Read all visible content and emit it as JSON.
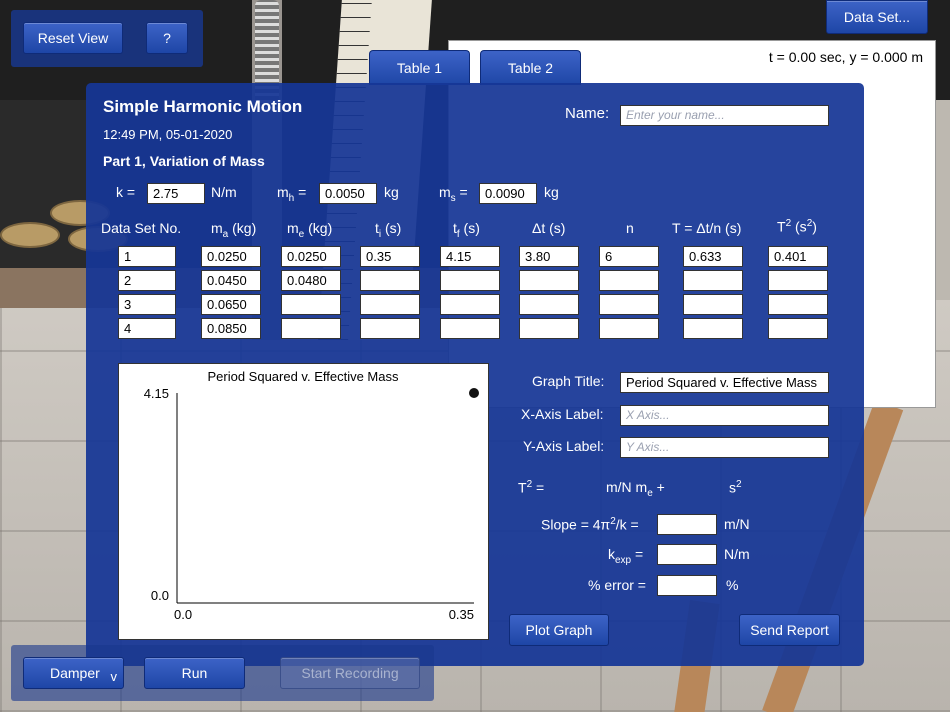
{
  "toolbar": {
    "reset_view": "Reset View",
    "help": "?",
    "data_set": "Data Set..."
  },
  "graph_window": {
    "readout": "t = 0.00 sec,  y = 0.000 m"
  },
  "tabs": [
    {
      "label": "Table 1",
      "active": true
    },
    {
      "label": "Table 2",
      "active": false
    }
  ],
  "panel": {
    "title": "Simple Harmonic Motion",
    "timestamp": "12:49 PM, 05-01-2020",
    "part": "Part 1, Variation of Mass",
    "name_label": "Name:",
    "name_placeholder": "Enter your name...",
    "name_value": ""
  },
  "constants": {
    "k_label": "k =",
    "k_value": "2.75",
    "k_unit": "N/m",
    "mh_label": "m",
    "mh_sub": "h",
    "mh_eq": " =",
    "mh_value": "0.0050",
    "mh_unit": "kg",
    "ms_label": "m",
    "ms_sub": "s",
    "ms_eq": " =",
    "ms_value": "0.0090",
    "ms_unit": "kg"
  },
  "table": {
    "headers": {
      "dataset": "Data Set No.",
      "ma": "m",
      "ma_sub": "a",
      "ma_unit": " (kg)",
      "me": "m",
      "me_sub": "e",
      "me_unit": " (kg)",
      "ti": "t",
      "ti_sub": "i",
      "ti_unit": " (s)",
      "tf": "t",
      "tf_sub": "f",
      "tf_unit": " (s)",
      "dt": "Δt (s)",
      "n": "n",
      "T": "T = Δt/n (s)",
      "T2": "T",
      "T2_sup": "2",
      "T2_unit": " (s",
      "T2_unit_sup": "2",
      "T2_unit_end": ")"
    },
    "rows": [
      {
        "no": "1",
        "ma": "0.0250",
        "me": "0.0250",
        "ti": "0.35",
        "tf": "4.15",
        "dt": "3.80",
        "n": "6",
        "T": "0.633",
        "T2": "0.401"
      },
      {
        "no": "2",
        "ma": "0.0450",
        "me": "0.0480",
        "ti": "",
        "tf": "",
        "dt": "",
        "n": "",
        "T": "",
        "T2": ""
      },
      {
        "no": "3",
        "ma": "0.0650",
        "me": "",
        "ti": "",
        "tf": "",
        "dt": "",
        "n": "",
        "T": "",
        "T2": ""
      },
      {
        "no": "4",
        "ma": "0.0850",
        "me": "",
        "ti": "",
        "tf": "",
        "dt": "",
        "n": "",
        "T": "",
        "T2": ""
      }
    ]
  },
  "graph": {
    "title_label": "Graph Title:",
    "title_value": "Period Squared v. Effective Mass",
    "x_label": "X-Axis Label:",
    "x_placeholder": "X Axis...",
    "y_label": "Y-Axis Label:",
    "y_placeholder": "Y Axis..."
  },
  "chart_data": {
    "type": "scatter",
    "title": "Period Squared v. Effective Mass",
    "xlabel": "",
    "ylabel": "",
    "xlim": [
      0.0,
      0.35
    ],
    "ylim": [
      0.0,
      4.15
    ],
    "x_tick_labels": [
      "0.0",
      "0.35"
    ],
    "y_tick_labels": [
      "0.0",
      "4.15"
    ],
    "series": [
      {
        "points": [
          {
            "x": 0.35,
            "y": 4.15
          }
        ],
        "color": "#111111"
      }
    ],
    "grid": false
  },
  "equation": {
    "t2": "T",
    "t2_sup": "2",
    "eq": " =",
    "mid": "m/N m",
    "mid_sub": "e",
    "plus": " +",
    "s": "s",
    "s_sup": "2"
  },
  "results": {
    "slope_label": "Slope = 4π",
    "slope_sup": "2",
    "slope_rest": "/k =",
    "slope_value": "",
    "slope_unit": "m/N",
    "kexp_label": "k",
    "kexp_sub": "exp",
    "kexp_eq": " =",
    "kexp_value": "",
    "kexp_unit": "N/m",
    "err_label": "% error =",
    "err_value": "",
    "err_unit": "%"
  },
  "actions": {
    "plot_graph": "Plot Graph",
    "send_report": "Send Report"
  },
  "bottom": {
    "damper": "Damper",
    "damper_chevron": "v",
    "run": "Run",
    "start_recording": "Start Recording"
  }
}
